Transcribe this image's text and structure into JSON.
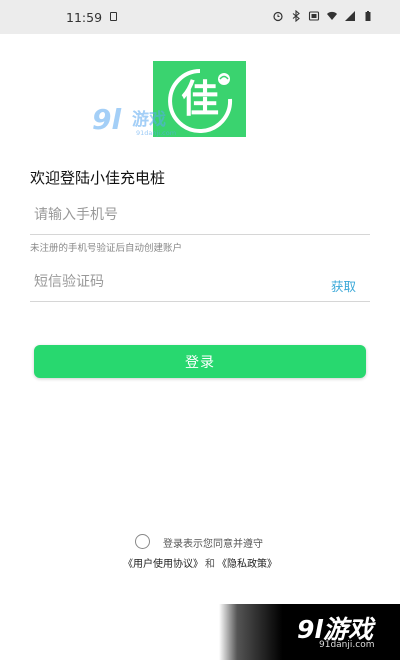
{
  "status_bar": {
    "time": "11:59",
    "icons": [
      "alarm-icon",
      "bluetooth-icon",
      "vibrate-icon",
      "wifi-icon",
      "signal-icon",
      "battery-icon"
    ]
  },
  "logo": {
    "color": "#3ad36f",
    "glyph": "佳"
  },
  "watermark_top": {
    "number": "9l",
    "text": "游戏",
    "url": "91danji.com"
  },
  "welcome": "欢迎登陆小佳充电桩",
  "phone_field": {
    "placeholder": "请输入手机号",
    "value": ""
  },
  "hint": "未注册的手机号验证后自动创建账户",
  "code_field": {
    "placeholder": "短信验证码",
    "value": "",
    "get_code_label": "获取"
  },
  "login_button": {
    "label": "登录",
    "color": "#28d86f"
  },
  "agreement": {
    "text": "登录表示您同意并遵守",
    "user_agreement": "《用户使用协议》",
    "and": "和",
    "privacy_policy": "《隐私政策》"
  },
  "watermark_bottom": {
    "number": "9l",
    "text": "游戏",
    "url": "91danji.com"
  }
}
